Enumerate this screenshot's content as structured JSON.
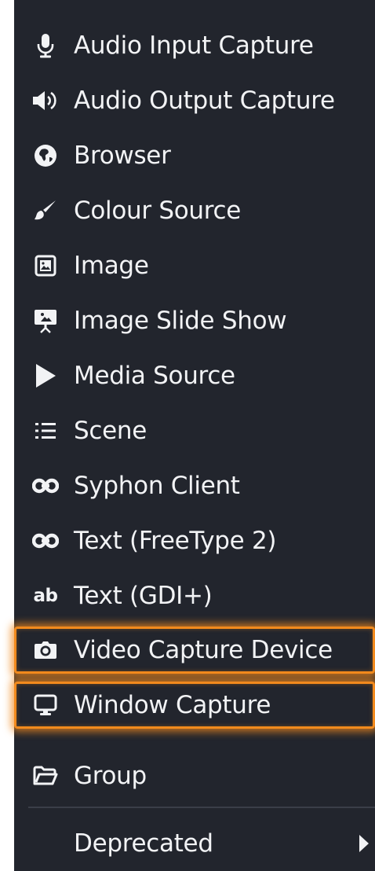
{
  "menu": {
    "items": [
      {
        "label": "Audio Input Capture",
        "icon": "microphone-icon"
      },
      {
        "label": "Audio Output Capture",
        "icon": "speaker-icon"
      },
      {
        "label": "Browser",
        "icon": "globe-icon"
      },
      {
        "label": "Colour Source",
        "icon": "paintbrush-icon"
      },
      {
        "label": "Image",
        "icon": "image-icon"
      },
      {
        "label": "Image Slide Show",
        "icon": "slideshow-icon"
      },
      {
        "label": "Media Source",
        "icon": "play-icon"
      },
      {
        "label": "Scene",
        "icon": "list-icon"
      },
      {
        "label": "Syphon Client",
        "icon": "link-icon"
      },
      {
        "label": "Text (FreeType 2)",
        "icon": "link-icon"
      },
      {
        "label": "Text (GDI+)",
        "icon": "text-ab-icon",
        "icon_text": "ab"
      },
      {
        "label": "Video Capture Device",
        "icon": "camera-icon",
        "highlighted": true
      },
      {
        "label": "Window Capture",
        "icon": "monitor-icon",
        "highlighted": true
      },
      {
        "label": "Group",
        "icon": "folder-icon"
      },
      {
        "label": "Deprecated",
        "icon": "",
        "submenu": true
      }
    ]
  },
  "colors": {
    "menu_background": "#22252d",
    "text": "#f2f3f5",
    "highlight": "#f28a1d",
    "separator": "#3a3e48"
  }
}
